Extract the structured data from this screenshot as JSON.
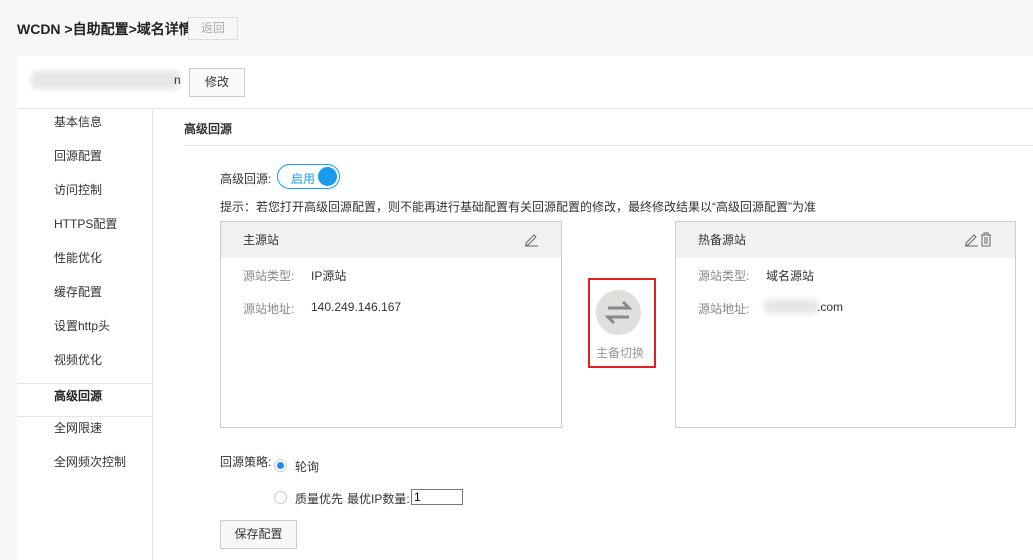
{
  "header": {
    "breadcrumb": "WCDN >自助配置>域名详情",
    "back_label": "返回"
  },
  "domain": {
    "visible_suffix": "n",
    "edit_label": "修改"
  },
  "sidebar": {
    "items": [
      {
        "label": "基本信息"
      },
      {
        "label": "回源配置"
      },
      {
        "label": "访问控制"
      },
      {
        "label": "HTTPS配置"
      },
      {
        "label": "性能优化"
      },
      {
        "label": "缓存配置"
      },
      {
        "label": "设置http头"
      },
      {
        "label": "视频优化"
      },
      {
        "label": "高级回源",
        "active": true
      },
      {
        "label": "全网限速"
      },
      {
        "label": "全网频次控制"
      }
    ]
  },
  "section": {
    "title": "高级回源",
    "adv_label": "高级回源:",
    "toggle_label": "启用",
    "toggle_on": true,
    "tip": "提示：若您打开高级回源配置，则不能再进行基础配置有关回源配置的修改，最终修改结果以“高级回源配置”为准"
  },
  "primary": {
    "title": "主源站",
    "type_label": "源站类型:",
    "type_value": "IP源站",
    "addr_label": "源站地址:",
    "addr_value": "140.249.146.167"
  },
  "backup": {
    "title": "热备源站",
    "type_label": "源站类型:",
    "type_value": "域名源站",
    "addr_label": "源站地址:",
    "addr_suffix": ".com"
  },
  "switch": {
    "label": "主备切换"
  },
  "strategy": {
    "label": "回源策略:",
    "options": [
      {
        "label": "轮询",
        "selected": true
      },
      {
        "label": "质量优先",
        "selected": false
      }
    ],
    "ip_count_label": "最优IP数量:",
    "ip_count_value": "1"
  },
  "save_label": "保存配置",
  "colors": {
    "accent": "#1c9af0",
    "highlight": "#e02020"
  }
}
